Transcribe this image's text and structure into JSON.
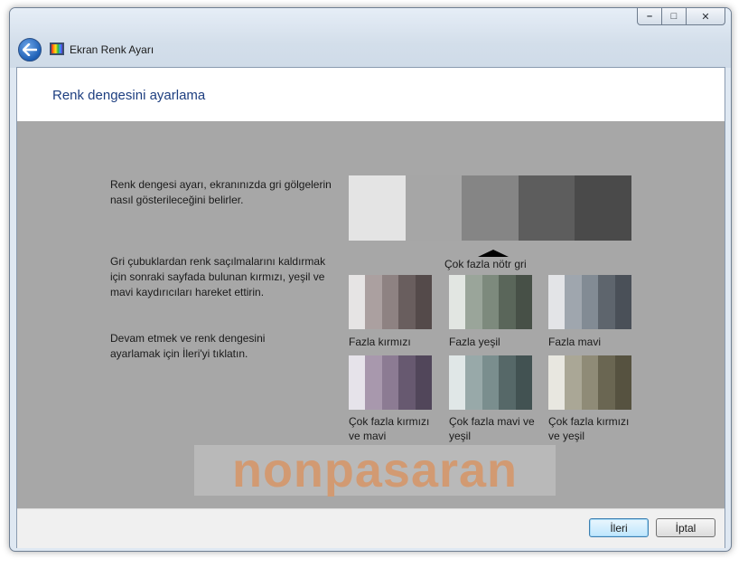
{
  "window": {
    "title": "Ekran Renk Ayarı",
    "caption_buttons": {
      "minimize": "–",
      "maximize": "□",
      "close": "✕"
    }
  },
  "page": {
    "heading": "Renk dengesini ayarlama",
    "paragraph1": "Renk dengesi ayarı, ekranınızda gri gölgelerin nasıl gösterileceğini belirler.",
    "paragraph2": "Gri çubuklardan renk saçılmalarını kaldırmak için sonraki sayfada bulunan kırmızı, yeşil ve mavi kaydırıcıları hareket ettirin.",
    "paragraph3": "Devam etmek ve renk dengesini ayarlamak için İleri'yi tıklatın."
  },
  "ramp": {
    "colors": [
      "#e4e4e4",
      "#a6a6a6",
      "#858585",
      "#5d5d5d",
      "#4a4a4a"
    ],
    "label": "Çok fazla nötr gri"
  },
  "swatches": [
    {
      "label": "Fazla kırmızı",
      "colors": [
        "#e6e4e4",
        "#aba0a0",
        "#8e8282",
        "#695e5e",
        "#544a4a"
      ]
    },
    {
      "label": "Fazla yeşil",
      "colors": [
        "#e2e6e2",
        "#9aa59a",
        "#7d8a7d",
        "#5a665a",
        "#475047"
      ]
    },
    {
      "label": "Fazla mavi",
      "colors": [
        "#e3e4e7",
        "#9fa6ae",
        "#828b94",
        "#5e656d",
        "#4a5058"
      ]
    },
    {
      "label": "Çok fazla kırmızı ve mavi",
      "colors": [
        "#e6e3ea",
        "#a898ad",
        "#8c7b93",
        "#675970",
        "#51465a"
      ]
    },
    {
      "label": "Çok fazla mavi ve yeşil",
      "colors": [
        "#e0e7e7",
        "#98a9a9",
        "#7a8e8e",
        "#566868",
        "#425252"
      ]
    },
    {
      "label": "Çok fazla kırmızı ve yeşil",
      "colors": [
        "#e8e7e0",
        "#aaa796",
        "#8f8b77",
        "#6a6652",
        "#565240"
      ]
    }
  ],
  "watermark": "nonpasaran",
  "footer": {
    "next_label": "İleri",
    "cancel_label": "İptal"
  }
}
